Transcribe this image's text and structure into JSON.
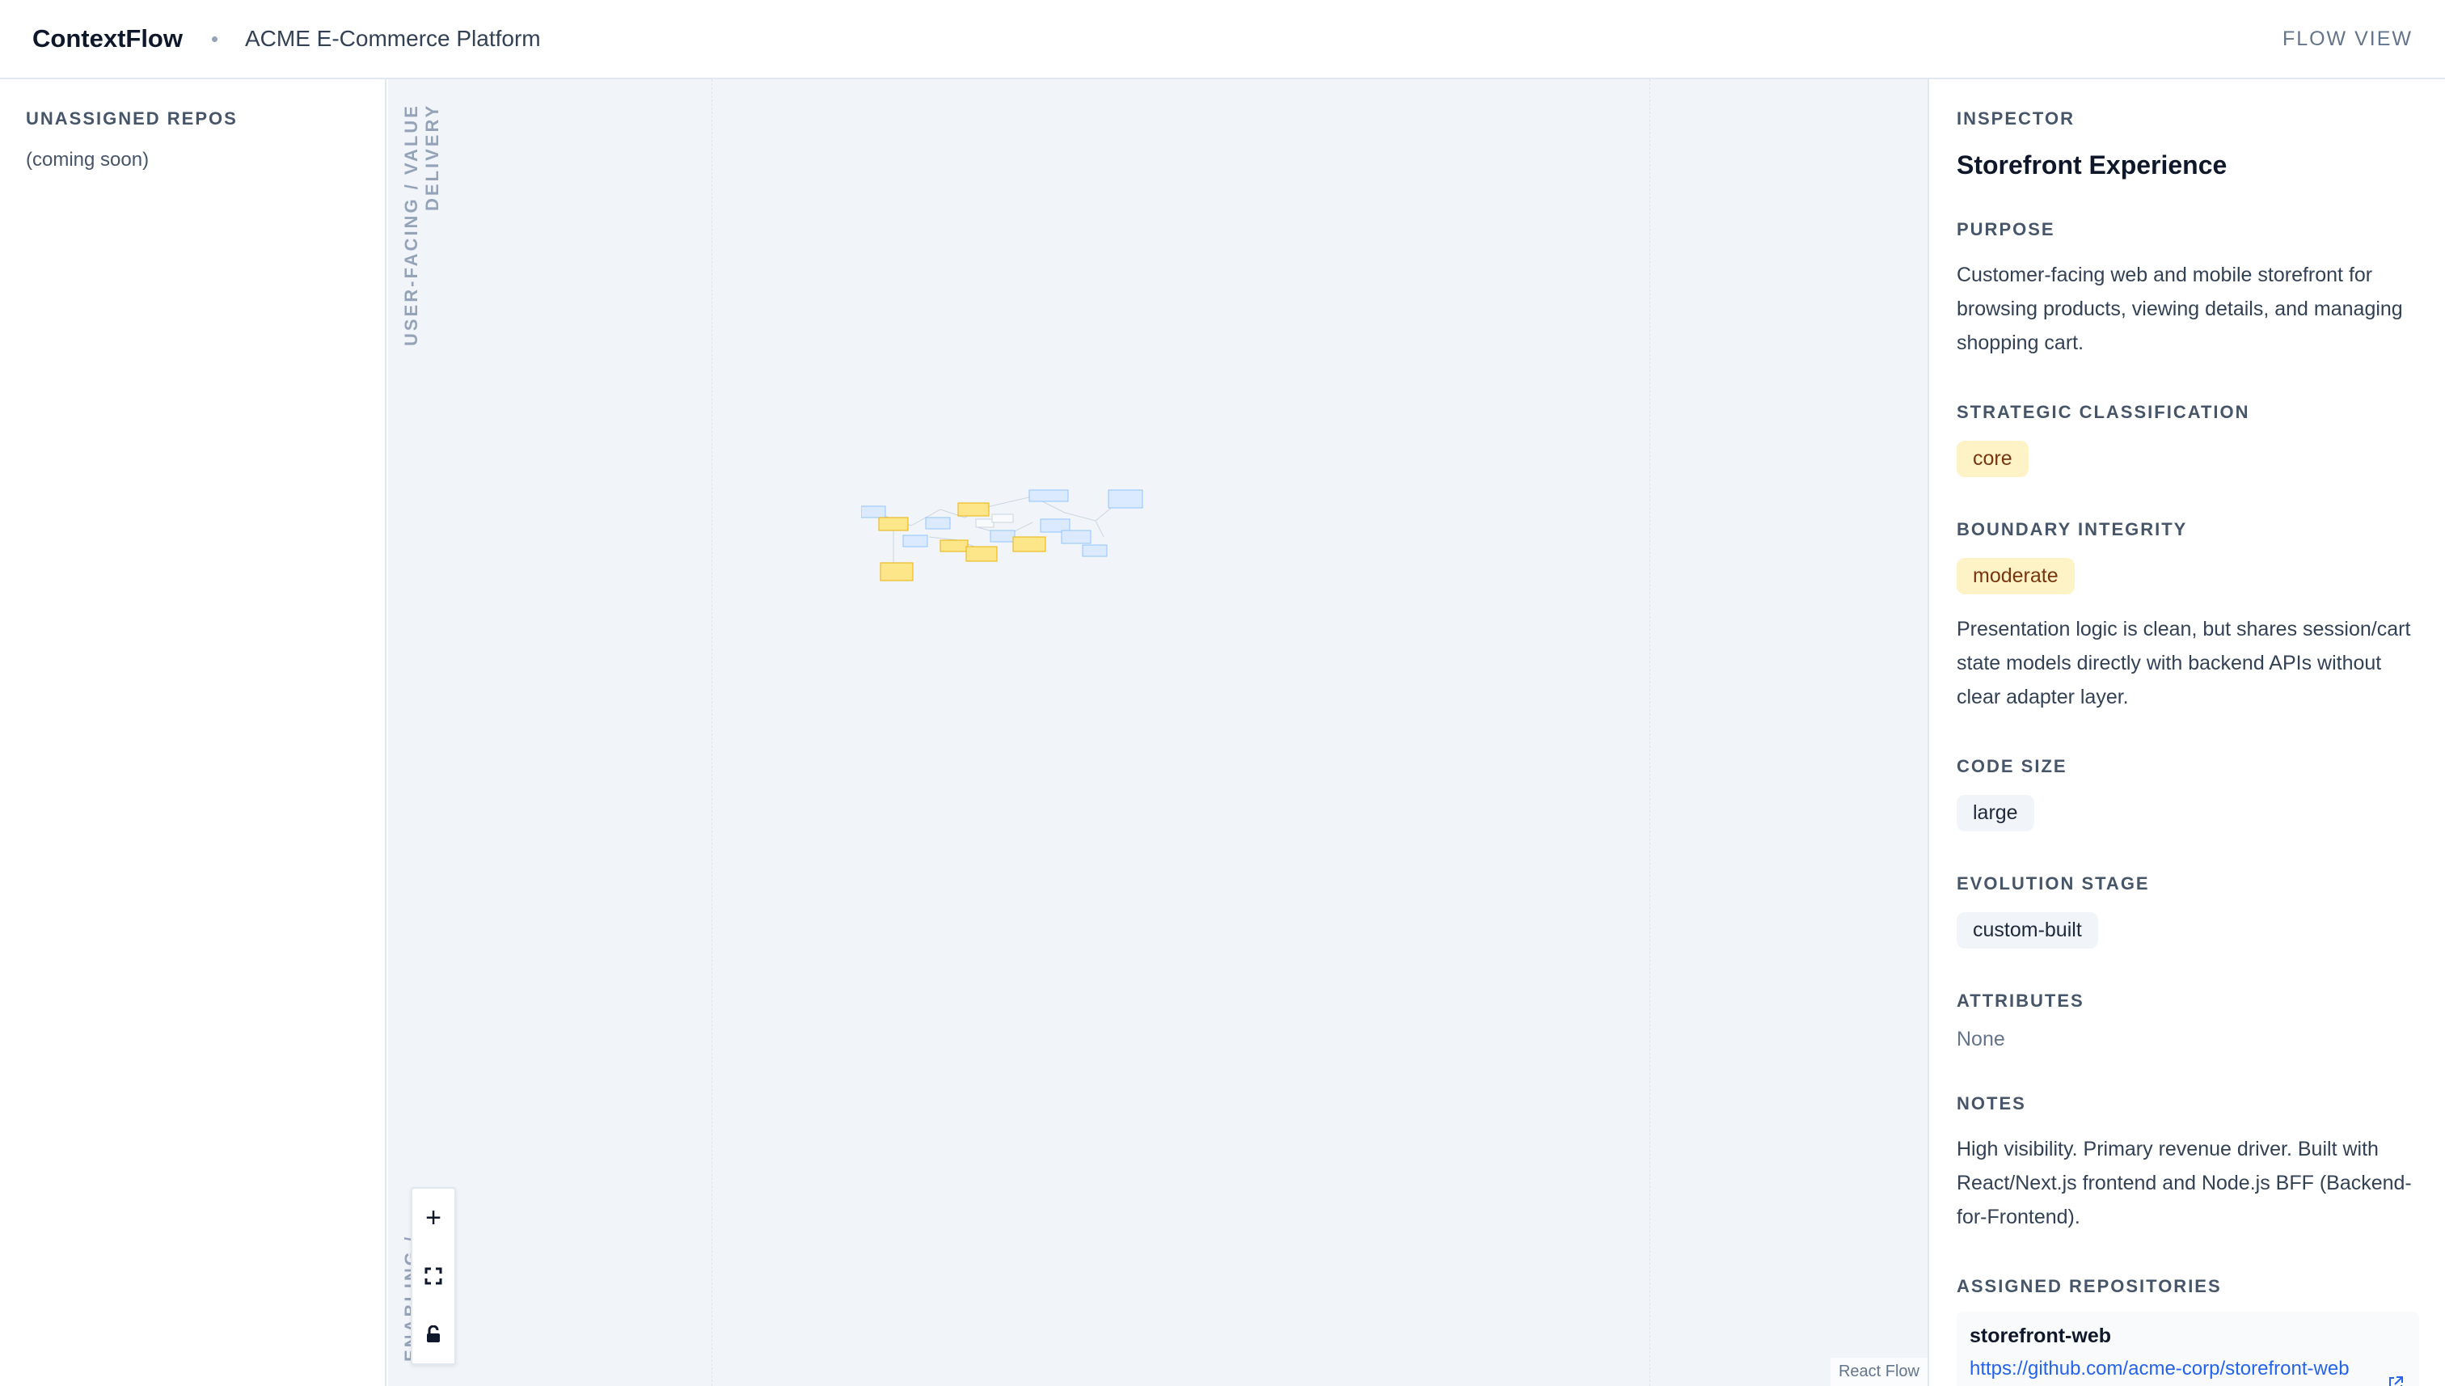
{
  "header": {
    "app_name": "ContextFlow",
    "project_name": "ACME E-Commerce Platform",
    "view_mode": "FLOW VIEW"
  },
  "left_panel": {
    "title": "UNASSIGNED REPOS",
    "placeholder": "(coming soon)"
  },
  "canvas": {
    "lane_top": "USER-FACING / VALUE DELIVERY",
    "lane_bottom": "ENABLING / PLATFORM",
    "controls": {
      "zoom_in": "+",
      "fit_view": "fit-view-icon",
      "lock": "lock-icon"
    },
    "attribution": "React Flow"
  },
  "inspector": {
    "header": "INSPECTOR",
    "title": "Storefront Experience",
    "purpose_label": "PURPOSE",
    "purpose": "Customer-facing web and mobile storefront for browsing products, viewing details, and managing shopping cart.",
    "classification_label": "STRATEGIC CLASSIFICATION",
    "classification": "core",
    "boundary_label": "BOUNDARY INTEGRITY",
    "boundary": "moderate",
    "boundary_notes": "Presentation logic is clean, but shares session/cart state models directly with backend APIs without clear adapter layer.",
    "code_size_label": "CODE SIZE",
    "code_size": "large",
    "evolution_label": "EVOLUTION STAGE",
    "evolution": "custom-built",
    "attributes_label": "ATTRIBUTES",
    "attributes": "None",
    "notes_label": "NOTES",
    "notes": "High visibility. Primary revenue driver. Built with React/Next.js frontend and Node.js BFF (Backend-for-Frontend).",
    "repos_label": "ASSIGNED REPOSITORIES",
    "repos": [
      {
        "name": "storefront-web",
        "url": "https://github.com/acme-corp/storefront-web"
      }
    ]
  },
  "colors": {
    "core_badge_bg": "#fef3c7",
    "link": "#2563eb",
    "canvas_bg": "#f1f5f9"
  }
}
